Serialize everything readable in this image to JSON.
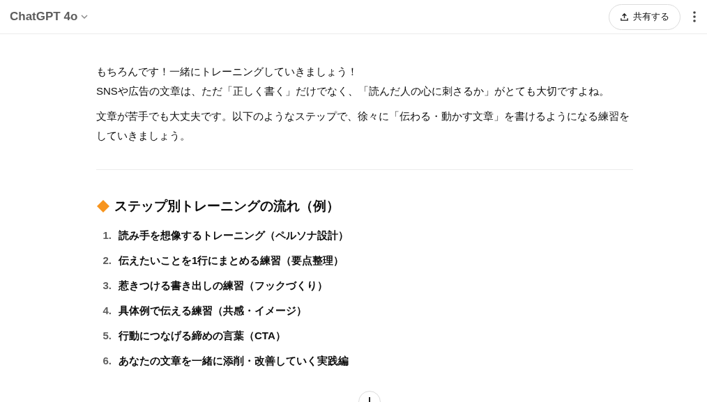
{
  "header": {
    "model": "ChatGPT 4o",
    "share_button": "共有する"
  },
  "message": {
    "paragraphs": [
      [
        "もちろんです！一緒にトレーニングしていきましょう！",
        "SNSや広告の文章は、ただ「正しく書く」だけでなく、「読んだ人の心に刺さるか」がとても大切ですよね。"
      ],
      [
        "文章が苦手でも大丈夫です。以下のようなステップで、徐々に「伝わる・動かす文章」を書けるようになる練習をしていきましょう。"
      ]
    ],
    "heading": "ステップ別トレーニングの流れ（例）",
    "steps": [
      {
        "number": "1.",
        "text": "読み手を想像するトレーニング（ペルソナ設計）"
      },
      {
        "number": "2.",
        "text": "伝えたいことを1行にまとめる練習（要点整理）"
      },
      {
        "number": "3.",
        "text": "惹きつける書き出しの練習（フックづくり）"
      },
      {
        "number": "4.",
        "text": "具体例で伝える練習（共感・イメージ）"
      },
      {
        "number": "5.",
        "text": "行動につなげる締めの言葉（CTA）"
      },
      {
        "number": "6.",
        "text": "あなたの文章を一緒に添削・改善していく実践編"
      }
    ]
  }
}
